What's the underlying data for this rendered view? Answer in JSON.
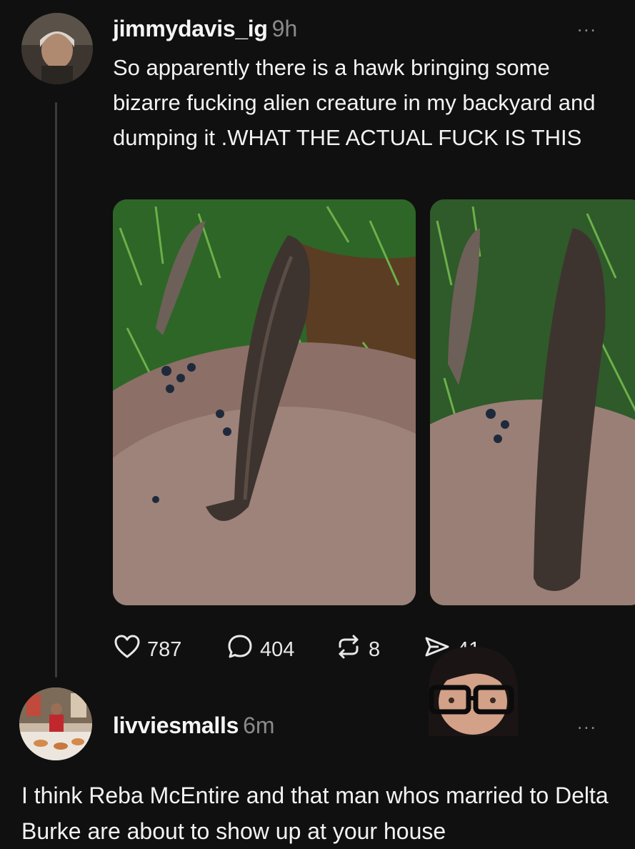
{
  "post": {
    "username": "jimmydavis_ig",
    "time": "9h",
    "text": "So apparently there is a hawk bringing some bizarre fucking alien creature in my backyard and dumping it .WHAT THE ACTUAL FUCK IS THIS",
    "more": "...",
    "stats": {
      "likes": "787",
      "comments": "404",
      "reposts": "8",
      "shares": "41"
    }
  },
  "reply": {
    "username": "livviesmalls",
    "time": "6m",
    "more": "...",
    "text": "I think Reba McEntire and that man whos married to Delta Burke are about to show up at your house"
  },
  "icons": {
    "like": "heart-icon",
    "comment": "comment-bubble-icon",
    "repost": "repost-icon",
    "share": "share-send-icon"
  }
}
